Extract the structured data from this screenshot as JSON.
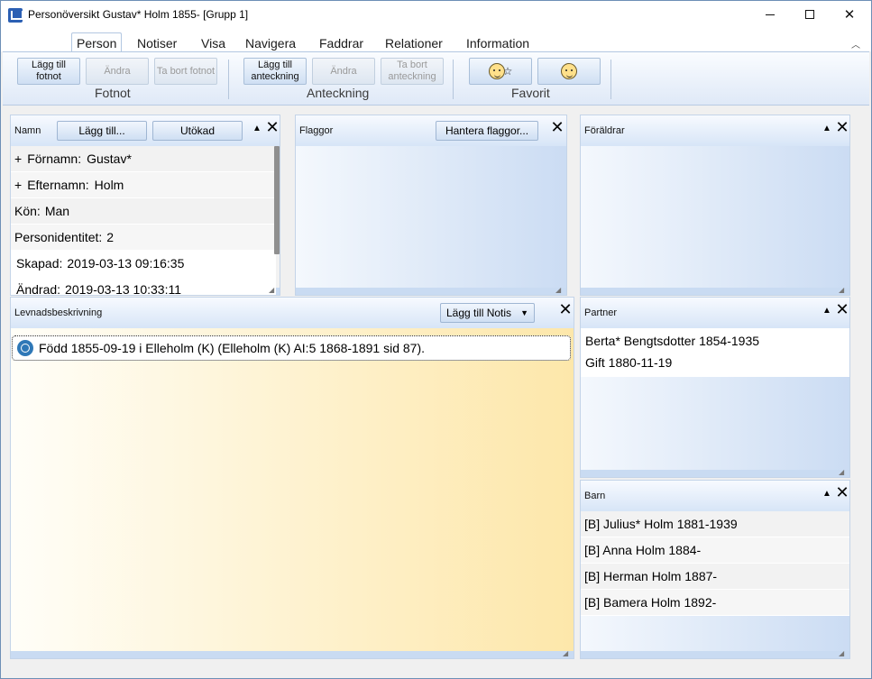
{
  "window": {
    "title": "Personöversikt Gustav* Holm 1855- [Grupp 1]"
  },
  "ribbon": {
    "tabs": [
      "Person",
      "Notiser",
      "Visa",
      "Navigera",
      "Faddrar",
      "Relationer",
      "Information"
    ],
    "active_tab": "Person",
    "groups": {
      "fotnot": {
        "label": "Fotnot",
        "add": "Lägg till fotnot",
        "edit": "Ändra",
        "remove": "Ta bort fotnot"
      },
      "anteckning": {
        "label": "Anteckning",
        "add": "Lägg till anteckning",
        "edit": "Ändra",
        "remove": "Ta bort anteckning"
      },
      "favorit": {
        "label": "Favorit"
      }
    }
  },
  "panels": {
    "namn": {
      "title": "Namn",
      "add_button": "Lägg till...",
      "extended_button": "Utökad",
      "rows": [
        {
          "prefix": "+",
          "label": "Förnamn:",
          "value": "Gustav*"
        },
        {
          "prefix": "+",
          "label": "Efternamn:",
          "value": "Holm"
        },
        {
          "prefix": "",
          "label": "Kön:",
          "value": "Man"
        },
        {
          "prefix": "",
          "label": "Personidentitet:",
          "value": "2"
        },
        {
          "prefix": "",
          "label": "Skapad:",
          "value": "2019-03-13  09:16:35"
        },
        {
          "prefix": "",
          "label": "Ändrad:",
          "value": "2019-03-13  10:33:11"
        }
      ]
    },
    "flaggor": {
      "title": "Flaggor",
      "manage_button": "Hantera flaggor..."
    },
    "foraldrar": {
      "title": "Föräldrar"
    },
    "levnad": {
      "title": "Levnadsbeskrivning",
      "add_button": "Lägg till Notis",
      "events": [
        {
          "text": "Född 1855-09-19 i Elleholm (K) (Elleholm (K) AI:5 1868-1891 sid 87)."
        }
      ]
    },
    "partner": {
      "title": "Partner",
      "lines": [
        "Berta* Bengtsdotter 1854-1935",
        "Gift 1880-11-19"
      ]
    },
    "barn": {
      "title": "Barn",
      "children": [
        "[B] Julius* Holm 1881-1939",
        "[B] Anna Holm 1884-",
        "[B] Herman Holm 1887-",
        "[B] Bamera Holm 1892-"
      ]
    }
  }
}
